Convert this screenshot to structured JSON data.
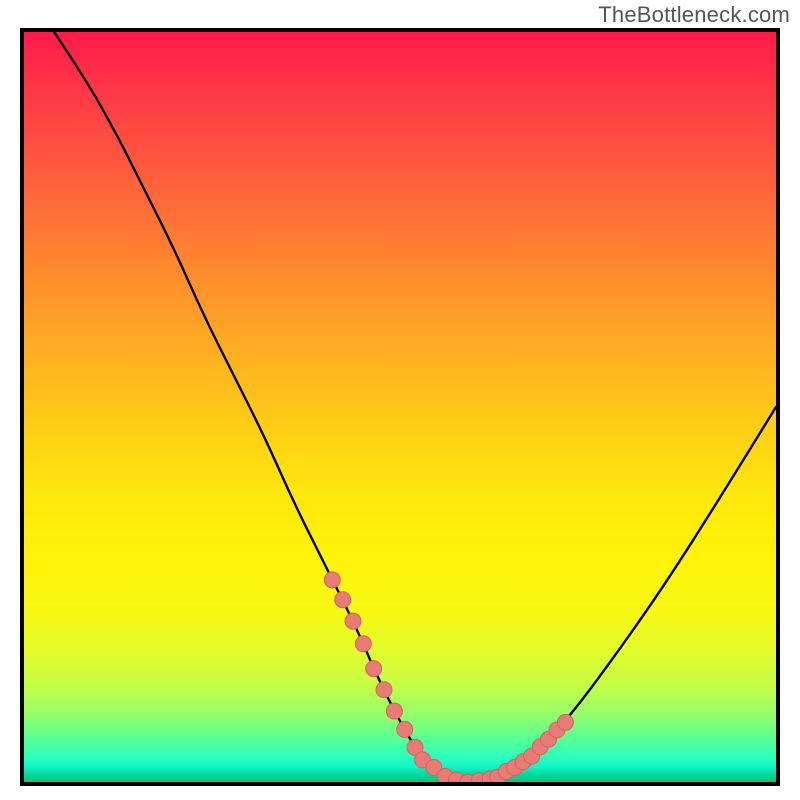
{
  "watermark": "TheBottleneck.com",
  "chart_data": {
    "type": "line",
    "title": "",
    "xlabel": "",
    "ylabel": "",
    "xlim": [
      0,
      100
    ],
    "ylim": [
      0,
      100
    ],
    "grid": false,
    "legend": false,
    "x": [
      4,
      8,
      12,
      16,
      20,
      24,
      28,
      32,
      36,
      40,
      44,
      47,
      50,
      53,
      56,
      58,
      60,
      63,
      67,
      72,
      78,
      85,
      92,
      100
    ],
    "values": [
      100,
      94,
      87,
      79,
      71,
      62,
      54,
      46,
      37,
      29,
      21,
      14,
      8,
      3,
      0.8,
      0,
      0,
      0.7,
      3,
      8,
      16,
      26,
      37,
      50
    ],
    "markers": {
      "left_cluster": {
        "x_range": [
          41,
          52
        ],
        "y_range": [
          3,
          23
        ],
        "count": 9
      },
      "flat_cluster": {
        "x_range": [
          53,
          62
        ],
        "y_range": [
          0,
          1
        ],
        "count": 7
      },
      "right_cluster": {
        "x_range": [
          63,
          72
        ],
        "y_range": [
          3,
          20
        ],
        "count": 9
      }
    },
    "background_gradient": {
      "stops": [
        {
          "pos": 0,
          "color": "#ff1a4a"
        },
        {
          "pos": 0.44,
          "color": "#ffb31f"
        },
        {
          "pos": 0.7,
          "color": "#fff308"
        },
        {
          "pos": 0.91,
          "color": "#95ff6a"
        },
        {
          "pos": 1.0,
          "color": "#05c57f"
        }
      ]
    }
  }
}
